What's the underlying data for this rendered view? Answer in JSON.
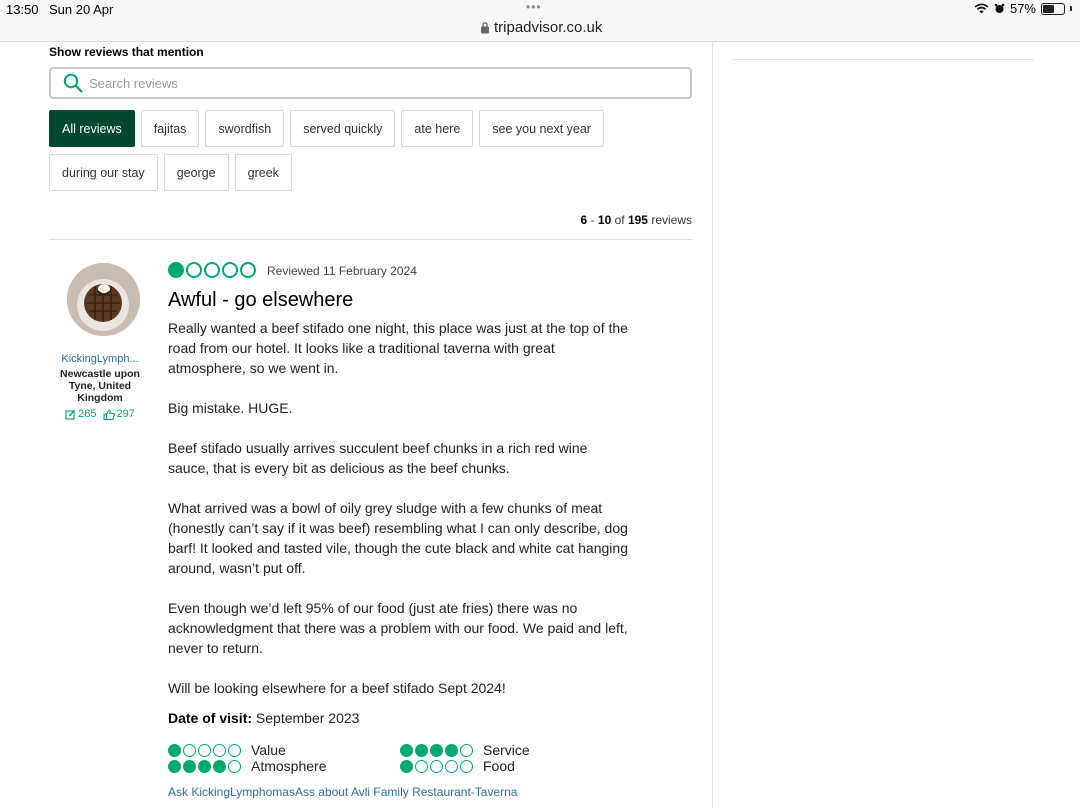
{
  "status_bar": {
    "time": "13:50",
    "date": "Sun 20 Apr",
    "url": "tripadvisor.co.uk",
    "battery_percent": "57%",
    "battery_level": 0.57
  },
  "filters": {
    "title": "Show reviews that mention",
    "search_placeholder": "Search reviews",
    "chips": [
      {
        "label": "All reviews",
        "active": true
      },
      {
        "label": "fajitas"
      },
      {
        "label": "swordfish"
      },
      {
        "label": "served quickly"
      },
      {
        "label": "ate here"
      },
      {
        "label": "see you next year"
      },
      {
        "label": "during our stay"
      },
      {
        "label": "george"
      },
      {
        "label": "greek"
      }
    ]
  },
  "pagination": {
    "from": "6",
    "sep": " - ",
    "to": "10",
    "of_text": " of ",
    "total": "195",
    "suffix": " reviews"
  },
  "reviewer": {
    "name": "KickingLymph...",
    "location": "Newcastle upon Tyne, United Kingdom",
    "contributions": "285",
    "helpful_votes": "297"
  },
  "review": {
    "rating": 1,
    "reviewed_date": "Reviewed 11 February 2024",
    "title": "Awful - go elsewhere",
    "paragraphs": [
      "Really wanted a beef stifado one night, this place was just at the top of the road from our hotel. It looks like a traditional taverna with great atmosphere, so we went in.",
      "Big mistake. HUGE.",
      "Beef stifado usually arrives succulent beef chunks in a rich red wine sauce, that is every bit as delicious as the beef chunks.",
      "What arrived was a bowl of oily grey sludge with a few chunks of meat (honestly can’t say if it was beef) resembling what I can only describe, dog barf! It looked and tasted vile, though the cute black and white cat hanging around, wasn’t put off.",
      "Even though we’d left 95% of our food (just ate fries) there was no acknowledgment that there was a problem with our food. We paid and left, never to return.",
      "Will be looking elsewhere for a beef stifado Sept 2024!"
    ],
    "visit_label": "Date of visit:",
    "visit_value": "September 2023",
    "subratings": [
      {
        "label": "Value",
        "rating": 1
      },
      {
        "label": "Service",
        "rating": 4
      },
      {
        "label": "Atmosphere",
        "rating": 4
      },
      {
        "label": "Food",
        "rating": 1
      }
    ],
    "ask_link": "Ask KickingLymphomasAss about Avli Family Restaurant-Taverna"
  },
  "colors": {
    "brand_green": "#00aa6c",
    "active_chip": "#00482e",
    "link_blue": "#2c6f9f"
  }
}
